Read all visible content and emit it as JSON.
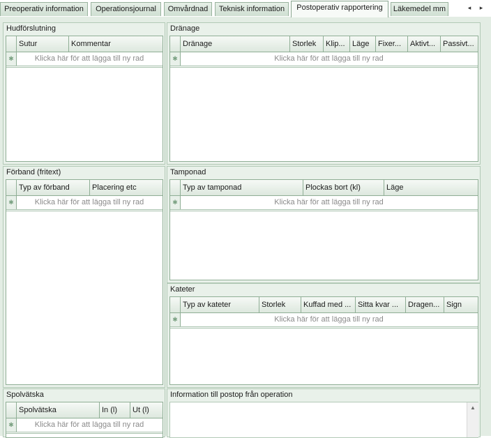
{
  "tabs": [
    {
      "label": "Preoperativ information",
      "active": false
    },
    {
      "label": "Operationsjournal",
      "active": false
    },
    {
      "label": "Omvårdnad",
      "active": false
    },
    {
      "label": "Teknisk information",
      "active": false
    },
    {
      "label": "Postoperativ rapportering",
      "active": true
    },
    {
      "label": "Läkemedel mm",
      "active": false
    }
  ],
  "tab_arrows": {
    "left": "◂",
    "right": "▸"
  },
  "new_row_hint": "Klicka här för att lägga till ny rad",
  "new_row_icon": "asterisk-icon",
  "groups": {
    "hudforslutning": {
      "title": "Hudförslutning",
      "columns": [
        "Sutur",
        "Kommentar"
      ]
    },
    "dranage": {
      "title": "Dränage",
      "columns": [
        "Dränage",
        "Storlek",
        "Klip...",
        "Läge",
        "Fixer...",
        "Aktivt...",
        "Passivt..."
      ]
    },
    "forband": {
      "title": "Förband (fritext)",
      "columns": [
        "Typ av förband",
        "Placering etc"
      ]
    },
    "tamponad": {
      "title": "Tamponad",
      "columns": [
        "Typ av tamponad",
        "Plockas bort (kl)",
        "Läge"
      ]
    },
    "kateter": {
      "title": "Kateter",
      "columns": [
        "Typ av kateter",
        "Storlek",
        "Kuffad med ...",
        "Sitta kvar ...",
        "Dragen...",
        "Sign"
      ]
    },
    "spolvatska": {
      "title": "Spolvätska",
      "columns": [
        "Spolvätska",
        "In (l)",
        "Ut (l)"
      ]
    },
    "information": {
      "title": "Information till postop från operation",
      "text": ""
    }
  },
  "colors": {
    "panel_bg": "#e9f1ea",
    "border": "#8fae95",
    "hint_text": "#8a8a8a"
  }
}
